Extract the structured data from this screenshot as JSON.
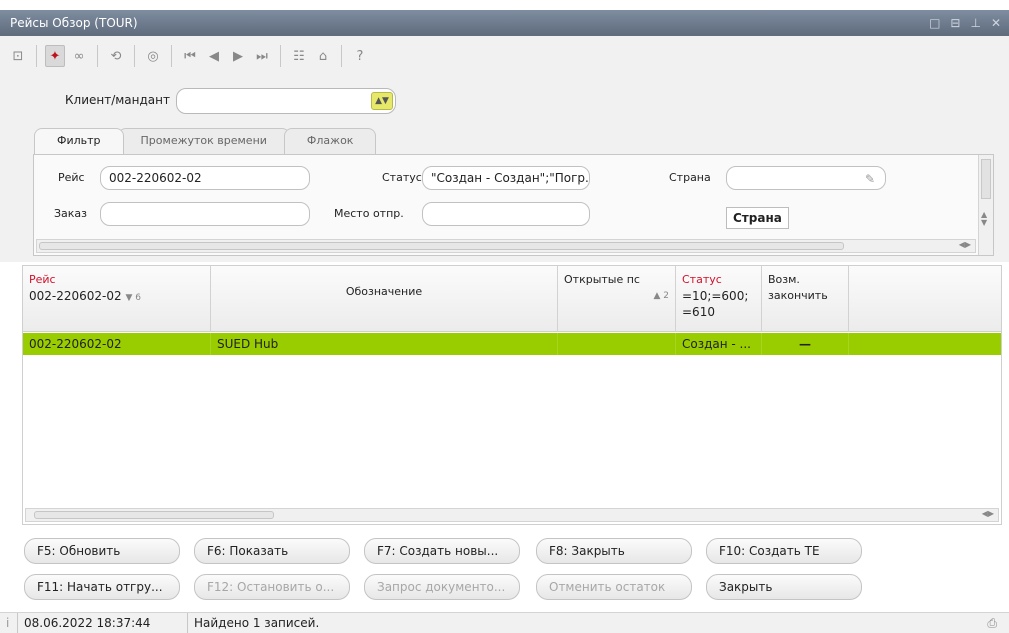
{
  "window": {
    "title": "Рейсы Обзор (TOUR)",
    "controls": [
      "□",
      "⊟",
      "⊥",
      "✕"
    ]
  },
  "client": {
    "label": "Клиент/мандант",
    "value": "",
    "button_icon": "▲▼"
  },
  "tabs": [
    {
      "label": "Фильтр",
      "active": true
    },
    {
      "label": "Промежуток времени",
      "active": false
    },
    {
      "label": "Флажок",
      "active": false
    }
  ],
  "filter": {
    "trip_label": "Рейс",
    "trip_value": "002-220602-02",
    "status_label": "Статус",
    "status_value": "\"Создан - Создан\";\"Погр.",
    "country_label": "Страна",
    "country_value": "",
    "order_label": "Заказ",
    "order_value": "",
    "origin_label": "Место отпр.",
    "origin_value": "",
    "country_button": "Страна"
  },
  "grid": {
    "columns": [
      {
        "label": "Рейс",
        "sub": "002-220602-02",
        "sort": "▼ 6",
        "red": true
      },
      {
        "label": "Обозначение",
        "sub": "",
        "sort": "",
        "red": false
      },
      {
        "label": "Открытые пс",
        "sub": "",
        "sort": "▲ 2",
        "red": false
      },
      {
        "label": "Статус",
        "sub": "=10;=600;",
        "sub2": "=610",
        "red": true
      },
      {
        "label": "Возм.",
        "sub": "закончить",
        "red": false
      }
    ],
    "rows": [
      {
        "trip": "002-220602-02",
        "name": "SUED Hub",
        "open": "",
        "status": "Создан - ...",
        "can_finish": "—"
      }
    ]
  },
  "buttons_row1": [
    {
      "label": "F5: Обновить",
      "disabled": false
    },
    {
      "label": "F6: Показать",
      "disabled": false
    },
    {
      "label": "F7: Создать новы...",
      "disabled": false
    },
    {
      "label": "F8: Закрыть",
      "disabled": false
    },
    {
      "label": "F10: Создать ТЕ",
      "disabled": false
    }
  ],
  "buttons_row2": [
    {
      "label": "F11: Начать отгру...",
      "disabled": false
    },
    {
      "label": "F12: Остановить о...",
      "disabled": true
    },
    {
      "label": "Запрос документо...",
      "disabled": true
    },
    {
      "label": "Отменить остаток",
      "disabled": true
    },
    {
      "label": "Закрыть",
      "disabled": false
    }
  ],
  "status": {
    "timestamp": "08.06.2022 18:37:44",
    "message": "Найдено 1 записей."
  },
  "colors": {
    "title_bar": "#6a778a",
    "row_selected": "#9acd00",
    "accent_red": "#d2102a",
    "client_button": "#e6e86a"
  }
}
